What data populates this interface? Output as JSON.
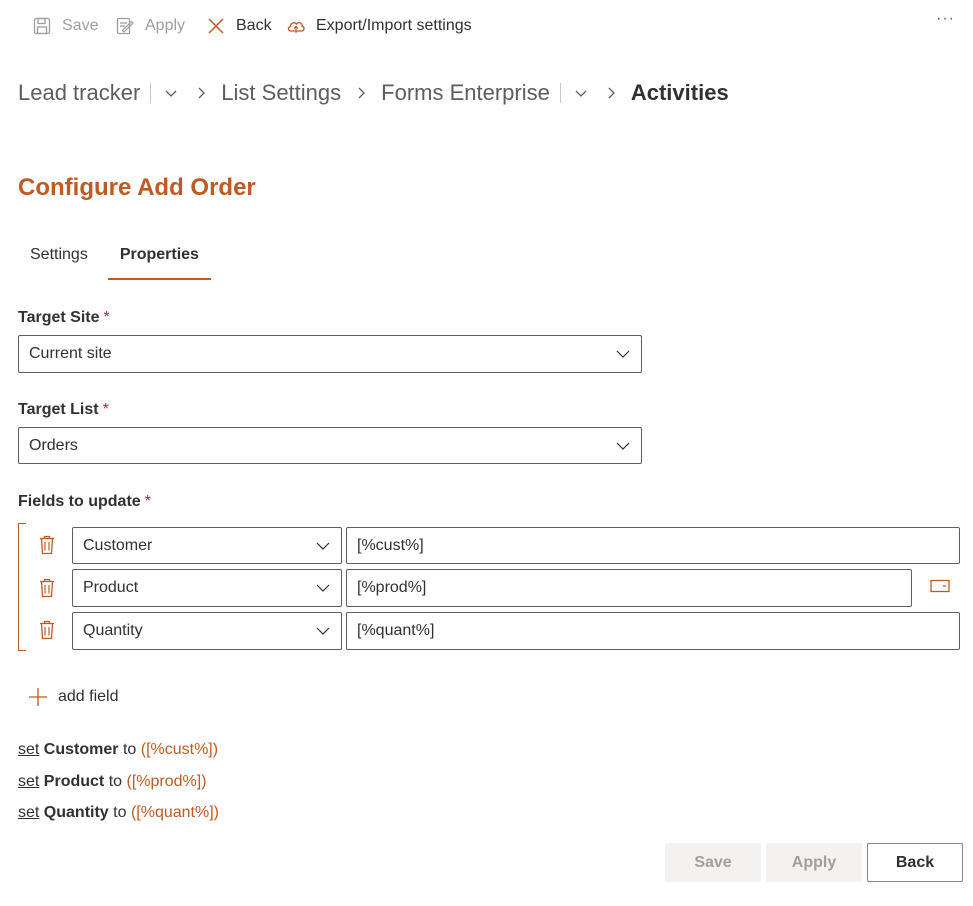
{
  "commandbar": {
    "save": "Save",
    "apply": "Apply",
    "back": "Back",
    "export": "Export/Import settings",
    "more": "···"
  },
  "breadcrumb": {
    "items": [
      "Lead tracker",
      "List Settings",
      "Forms Enterprise",
      "Activities"
    ]
  },
  "page": {
    "title": "Configure Add Order"
  },
  "tabs": [
    "Settings",
    "Properties"
  ],
  "form": {
    "target_site": {
      "label": "Target Site",
      "required": "*",
      "value": "Current site"
    },
    "target_list": {
      "label": "Target List",
      "required": "*",
      "value": "Orders"
    },
    "fields_to_update": {
      "label": "Fields to update",
      "required": "*",
      "rows": [
        {
          "field": "Customer",
          "value": "[%cust%]"
        },
        {
          "field": "Product",
          "value": "[%prod%]"
        },
        {
          "field": "Quantity",
          "value": "[%quant%]"
        }
      ]
    },
    "add_field": "add field"
  },
  "summary": [
    {
      "keyword": "set",
      "field": "Customer",
      "to": "to",
      "value": "([%cust%])"
    },
    {
      "keyword": "set",
      "field": "Product",
      "to": "to",
      "value": "([%prod%])"
    },
    {
      "keyword": "set",
      "field": "Quantity",
      "to": "to",
      "value": "([%quant%])"
    }
  ],
  "footer": {
    "save": "Save",
    "apply": "Apply",
    "back": "Back"
  },
  "colors": {
    "accent": "#c05a23",
    "text": "#323130",
    "disabled": "#a19f9d"
  }
}
